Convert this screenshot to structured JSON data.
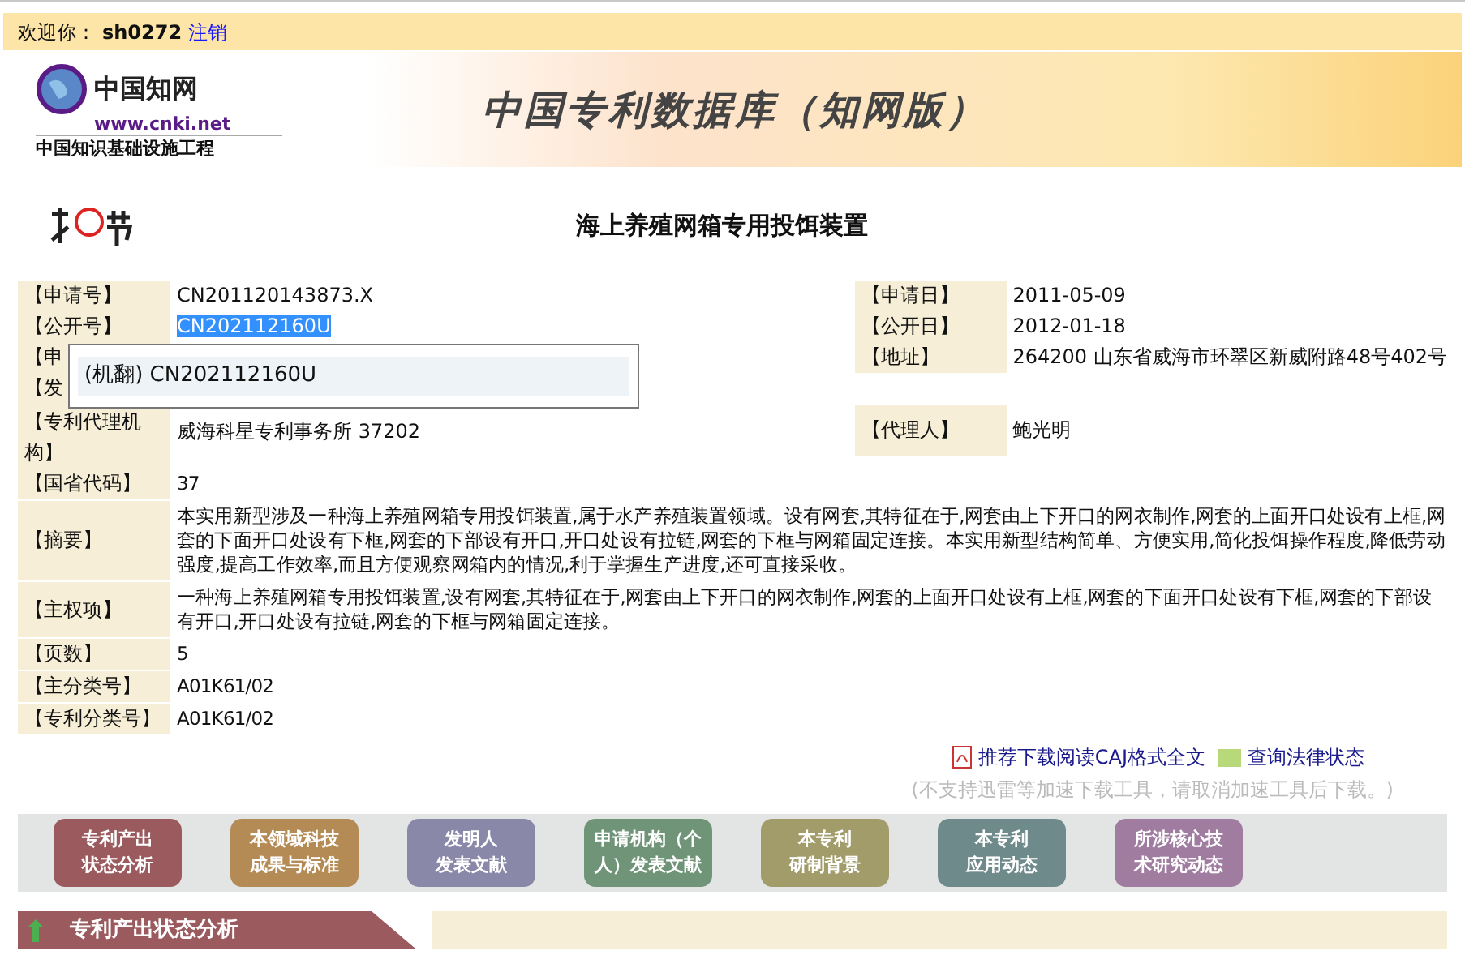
{
  "top_bar": {
    "greeting": "欢迎你：",
    "username": "sh0272",
    "logout_link": "注销"
  },
  "banner": {
    "logo_brand": "中国知网",
    "logo_url": "www.cnki.net",
    "logo_tagline": "中国知识基础设施工程",
    "title": "中国专利数据库（知网版）"
  },
  "patent_title": "海上养殖网箱专用投饵装置",
  "left_fields": [
    {
      "label": "【申请号】",
      "value": "CN201120143873.X",
      "selected": false
    },
    {
      "label": "【公开号】",
      "value": "CN202112160U",
      "selected": true
    },
    {
      "label": "【申"
    },
    {
      "label": "【发"
    },
    {
      "label": "【专利代理机构】",
      "value": "威海科星专利事务所 37202"
    }
  ],
  "right_fields": [
    {
      "label": "【申请日】",
      "value": "2011-05-09"
    },
    {
      "label": "【公开日】",
      "value": "2012-01-18"
    },
    {
      "label": "【地址】",
      "value": "264200 山东省威海市环翠区新威附路48号402号"
    },
    {
      "label": "【代理人】",
      "value": "鲍光明"
    }
  ],
  "fields": [
    {
      "label": "【国省代码】",
      "value": "37"
    },
    {
      "label": "【摘要】",
      "value": "本实用新型涉及一种海上养殖网箱专用投饵装置,属于水产养殖装置领域。设有网套,其特征在于,网套由上下开口的网衣制作,网套的上面开口处设有上框,网套的下面开口处设有下框,网套的下部设有开口,开口处设有拉链,网套的下框与网箱固定连接。本实用新型结构简单、方便实用,简化投饵操作程度,降低劳动强度,提高工作效率,而且方便观察网箱内的情况,利于掌握生产进度,还可直接采收。"
    },
    {
      "label": "【主权项】",
      "value": "一种海上养殖网箱专用投饵装置,设有网套,其特征在于,网套由上下开口的网衣制作,网套的上面开口处设有上框,网套的下面开口处设有下框,网套的下部设有开口,开口处设有拉链,网套的下框与网箱固定连接。"
    },
    {
      "label": "【页数】",
      "value": "5"
    },
    {
      "label": "【主分类号】",
      "value": "A01K61/02"
    },
    {
      "label": "【专利分类号】",
      "value": "A01K61/02"
    }
  ],
  "popup": {
    "item": "(机翻) CN202112160U"
  },
  "links": [
    {
      "kind": "pdf",
      "text": "推荐下载阅读CAJ格式全文"
    },
    {
      "kind": "legal",
      "text": "查询法律状态"
    }
  ],
  "download_note": "(不支持迅雷等加速下载工具，请取消加速工具后下载。)",
  "nav_buttons": [
    {
      "line1": "专利产出",
      "line2": "状态分析",
      "color": "#9a5a5e"
    },
    {
      "line1": "本领域科技",
      "line2": "成果与标准",
      "color": "#b48a55"
    },
    {
      "line1": "发明人",
      "line2": "发表文献",
      "color": "#8a88a8"
    },
    {
      "line1": "申请机构（个",
      "line2": "人）发表文献",
      "color": "#6f9478"
    },
    {
      "line1": "本专利",
      "line2": "研制背景",
      "color": "#a19c6a"
    },
    {
      "line1": "本专利",
      "line2": "应用动态",
      "color": "#6f8a8a"
    },
    {
      "line1": "所涉核心技",
      "line2": "术研究动态",
      "color": "#a07ca0"
    }
  ],
  "section_header": "专利产出状态分析"
}
